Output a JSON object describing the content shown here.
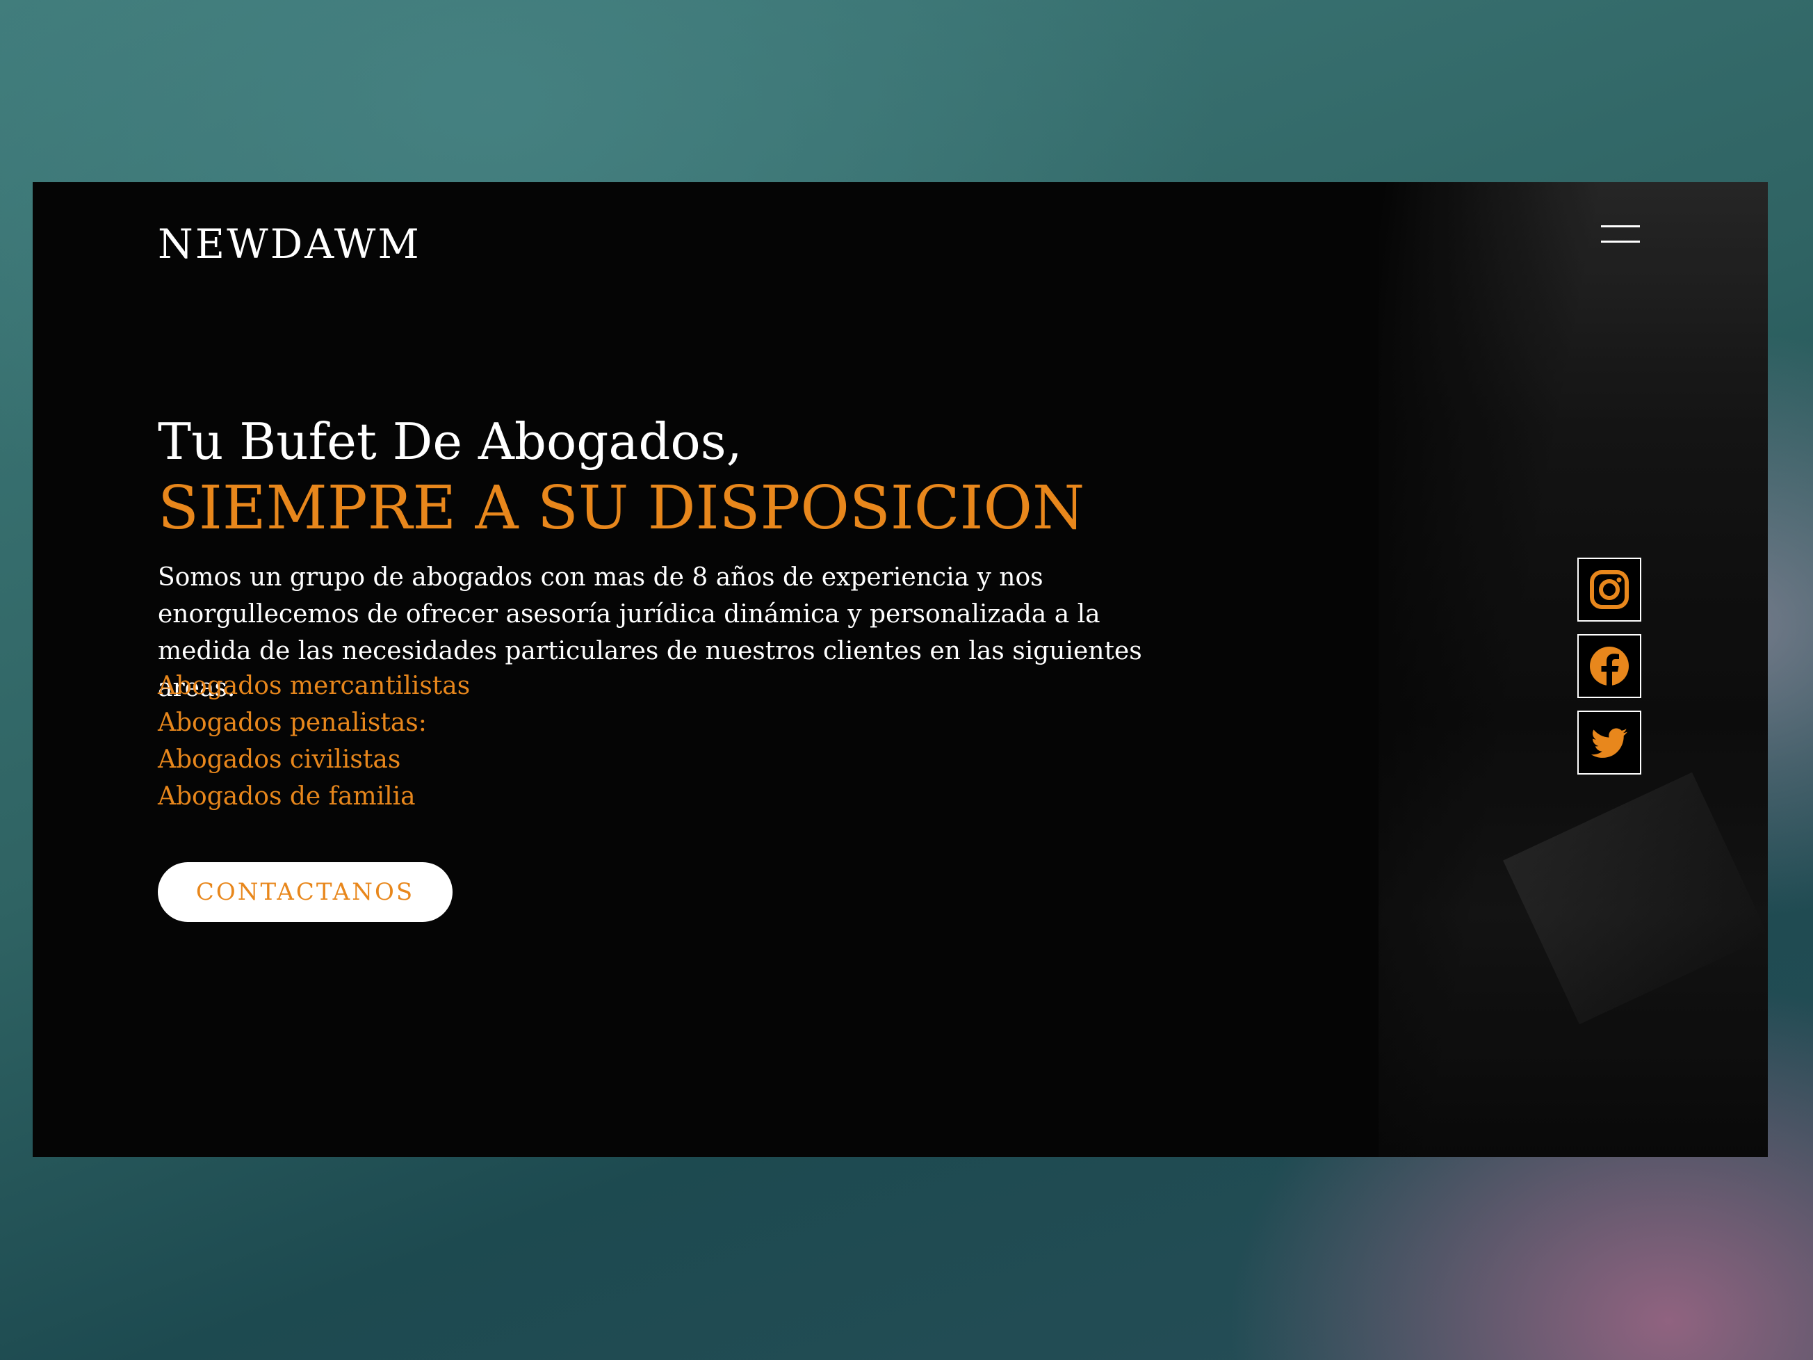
{
  "brand": {
    "logo": "NEWDAWM"
  },
  "nav": {
    "menu_icon": "hamburger-menu-icon"
  },
  "hero": {
    "headline_line1": "Tu Bufet De Abogados,",
    "headline_line2": "SIEMPRE A SU DISPOSICION",
    "description": "Somos un grupo de abogados con mas de 8 años de experiencia y nos enorgullecemos de ofrecer asesoría jurídica dinámica y personalizada a la medida de las necesidades particulares de nuestros clientes en las siguientes areas.",
    "areas": [
      "Abogados mercantilistas",
      "Abogados penalistas:",
      "Abogados civilistas",
      "Abogados de familia"
    ],
    "cta_label": "CONTACTANOS"
  },
  "social": [
    {
      "icon": "instagram-icon"
    },
    {
      "icon": "facebook-icon"
    },
    {
      "icon": "twitter-icon"
    }
  ],
  "colors": {
    "accent": "#e8871c",
    "background": "#050505",
    "text": "#ffffff"
  }
}
